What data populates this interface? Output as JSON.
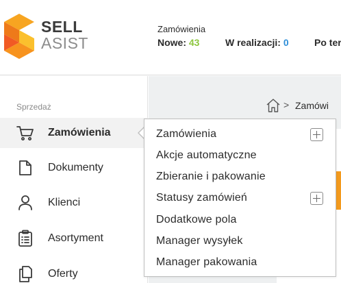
{
  "brand": {
    "name_line1": "SELL",
    "name_line2": "ASIST",
    "logo_icon": "sellasist-logo"
  },
  "header": {
    "orders_title": "Zamówienia",
    "stats": [
      {
        "label": "Nowe:",
        "value": "43",
        "color": "#8dc63f"
      },
      {
        "label": "W realizacji:",
        "value": "0",
        "color": "#2f8fd8"
      },
      {
        "label": "Po ter",
        "value": ""
      }
    ]
  },
  "sidebar": {
    "section_label": "Sprzedaż",
    "items": [
      {
        "label": "Zamówienia",
        "icon": "cart-icon",
        "active": true
      },
      {
        "label": "Dokumenty",
        "icon": "document-icon",
        "active": false
      },
      {
        "label": "Klienci",
        "icon": "user-icon",
        "active": false
      },
      {
        "label": "Asortyment",
        "icon": "clipboard-list-icon",
        "active": false
      },
      {
        "label": "Oferty",
        "icon": "copy-icon",
        "active": false
      }
    ]
  },
  "breadcrumb": {
    "home_icon": "home-icon",
    "separator": ">",
    "current": "Zamówi"
  },
  "dropdown": {
    "items": [
      {
        "label": "Zamówienia",
        "has_add": true
      },
      {
        "label": "Akcje automatyczne",
        "has_add": false
      },
      {
        "label": "Zbieranie i pakowanie",
        "has_add": false
      },
      {
        "label": "Statusy zamówień",
        "has_add": true
      },
      {
        "label": "Dodatkowe pola",
        "has_add": false
      },
      {
        "label": "Manager wysyłek",
        "has_add": false
      },
      {
        "label": "Manager pakowania",
        "has_add": false
      }
    ]
  },
  "colors": {
    "accent_orange": "#f39a1e",
    "new_count_green": "#8dc63f",
    "in_progress_blue": "#2f8fd8"
  }
}
